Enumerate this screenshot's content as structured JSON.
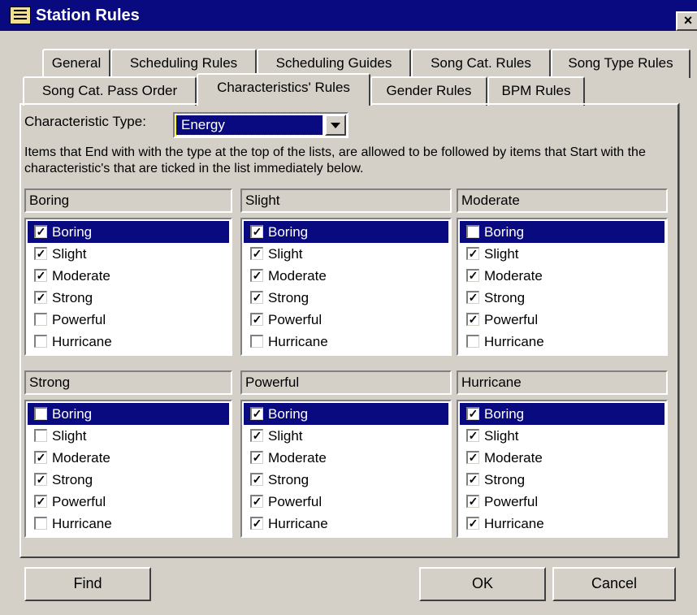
{
  "window": {
    "title": "Station Rules",
    "close_label": "×"
  },
  "tabs_row1": [
    "General",
    "Scheduling Rules",
    "Scheduling Guides",
    "Song Cat. Rules",
    "Song Type Rules"
  ],
  "tabs_row2": [
    "Song Cat. Pass Order",
    "Characteristics' Rules",
    "Gender Rules",
    "BPM Rules"
  ],
  "active_tab": "Characteristics' Rules",
  "characteristic_type": {
    "label": "Characteristic Type:",
    "value": "Energy"
  },
  "description": "Items that End with with the type at the top of the lists, are allowed to be followed by items that Start with the characteristic's that are ticked in the list immediately below.",
  "groups": [
    {
      "title": "Boring",
      "items": [
        {
          "label": "Boring",
          "checked": true,
          "selected": true
        },
        {
          "label": "Slight",
          "checked": true
        },
        {
          "label": "Moderate",
          "checked": true
        },
        {
          "label": "Strong",
          "checked": true
        },
        {
          "label": "Powerful",
          "checked": false
        },
        {
          "label": "Hurricane",
          "checked": false
        }
      ]
    },
    {
      "title": "Slight",
      "items": [
        {
          "label": "Boring",
          "checked": true,
          "selected": true
        },
        {
          "label": "Slight",
          "checked": true
        },
        {
          "label": "Moderate",
          "checked": true
        },
        {
          "label": "Strong",
          "checked": true
        },
        {
          "label": "Powerful",
          "checked": true
        },
        {
          "label": "Hurricane",
          "checked": false
        }
      ]
    },
    {
      "title": "Moderate",
      "items": [
        {
          "label": "Boring",
          "checked": false,
          "selected": true
        },
        {
          "label": "Slight",
          "checked": true
        },
        {
          "label": "Moderate",
          "checked": true
        },
        {
          "label": "Strong",
          "checked": true
        },
        {
          "label": "Powerful",
          "checked": true
        },
        {
          "label": "Hurricane",
          "checked": false
        }
      ]
    },
    {
      "title": "Strong",
      "items": [
        {
          "label": "Boring",
          "checked": false,
          "selected": true
        },
        {
          "label": "Slight",
          "checked": false
        },
        {
          "label": "Moderate",
          "checked": true
        },
        {
          "label": "Strong",
          "checked": true
        },
        {
          "label": "Powerful",
          "checked": true
        },
        {
          "label": "Hurricane",
          "checked": false
        }
      ]
    },
    {
      "title": "Powerful",
      "items": [
        {
          "label": "Boring",
          "checked": true,
          "selected": true
        },
        {
          "label": "Slight",
          "checked": true
        },
        {
          "label": "Moderate",
          "checked": true
        },
        {
          "label": "Strong",
          "checked": true
        },
        {
          "label": "Powerful",
          "checked": true
        },
        {
          "label": "Hurricane",
          "checked": true
        }
      ]
    },
    {
      "title": "Hurricane",
      "items": [
        {
          "label": "Boring",
          "checked": true,
          "selected": true
        },
        {
          "label": "Slight",
          "checked": true
        },
        {
          "label": "Moderate",
          "checked": true
        },
        {
          "label": "Strong",
          "checked": true
        },
        {
          "label": "Powerful",
          "checked": true
        },
        {
          "label": "Hurricane",
          "checked": true
        }
      ]
    }
  ],
  "buttons": {
    "find": "Find",
    "ok": "OK",
    "cancel": "Cancel"
  },
  "colors": {
    "titlebar": "#0a0a80",
    "face": "#d4d0c8",
    "selection": "#0a0a80"
  }
}
